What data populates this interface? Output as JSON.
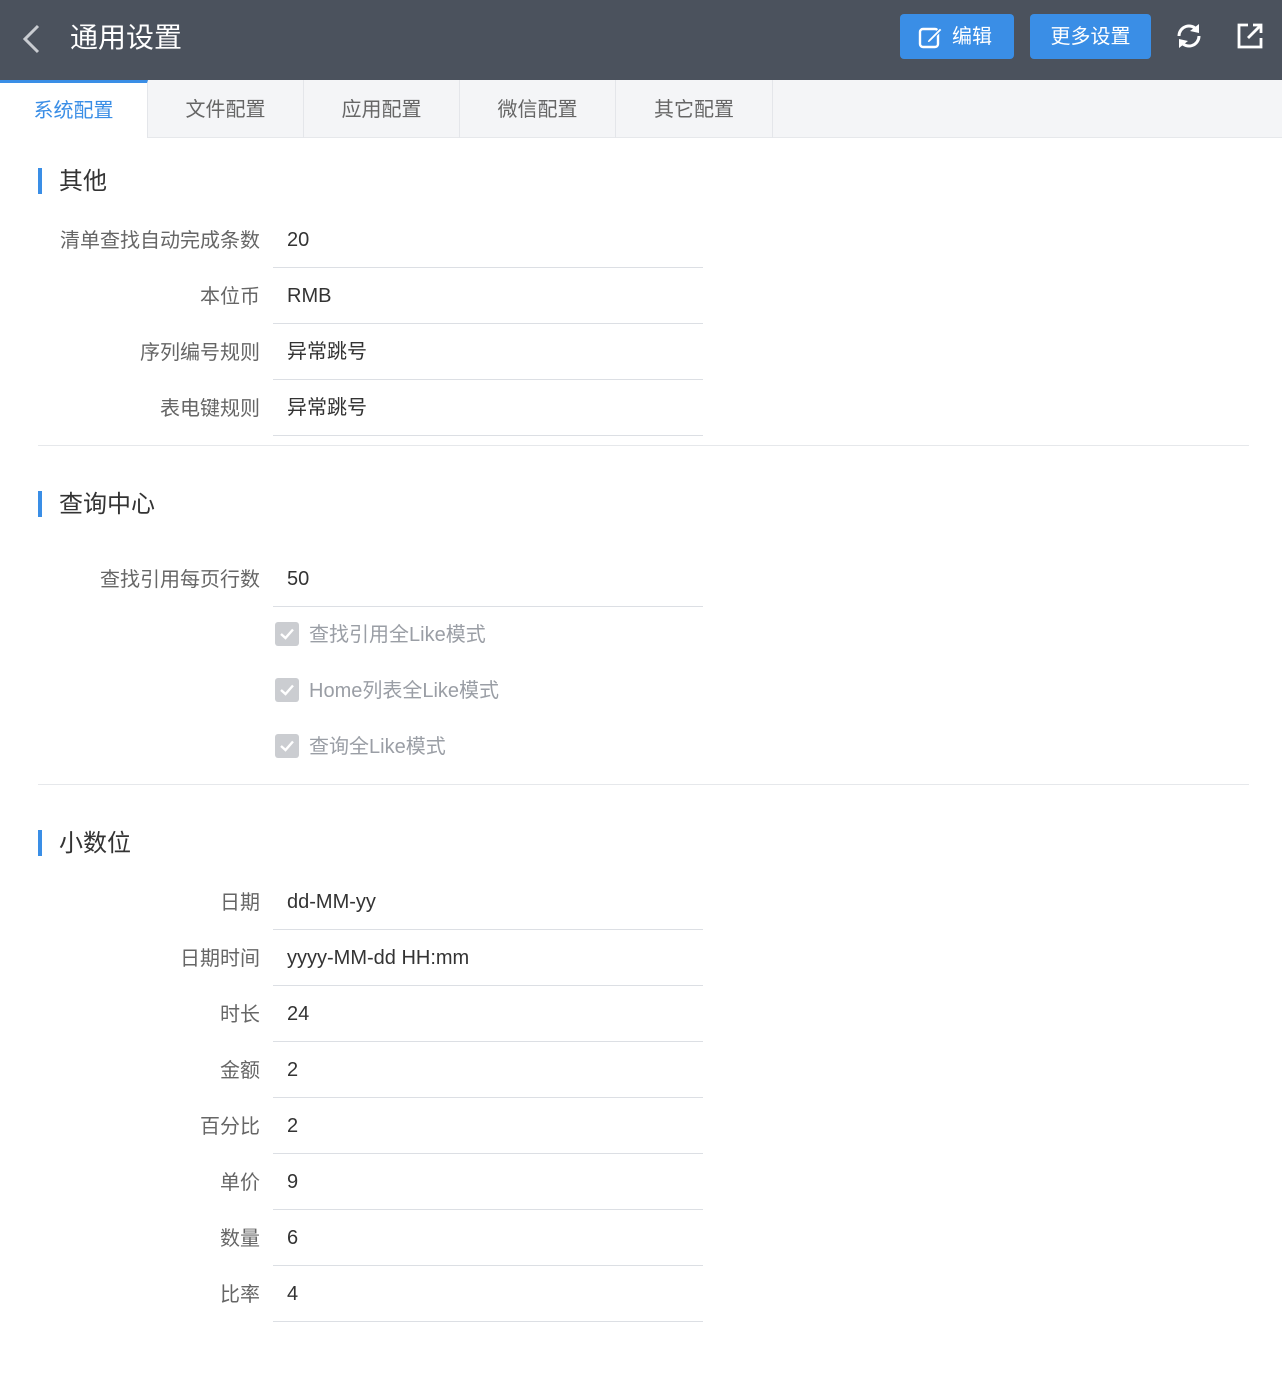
{
  "header": {
    "title": "通用设置",
    "edit_label": "编辑",
    "more_label": "更多设置",
    "icons": [
      "chevron-left-icon",
      "edit-icon",
      "refresh-icon",
      "export-icon"
    ]
  },
  "tabs": [
    {
      "label": "系统配置",
      "active": true
    },
    {
      "label": "文件配置",
      "active": false
    },
    {
      "label": "应用配置",
      "active": false
    },
    {
      "label": "微信配置",
      "active": false
    },
    {
      "label": "其它配置",
      "active": false
    }
  ],
  "sections": {
    "other": {
      "title": "其他",
      "fields": [
        {
          "label": "清单查找自动完成条数",
          "value": "20"
        },
        {
          "label": "本位币",
          "value": "RMB"
        },
        {
          "label": "序列编号规则",
          "value": "异常跳号"
        },
        {
          "label": "表电键规则",
          "value": "异常跳号"
        }
      ]
    },
    "query": {
      "title": "查询中心",
      "fields": [
        {
          "label": "查找引用每页行数",
          "value": "50"
        }
      ],
      "checkboxes": [
        {
          "label": "查找引用全Like模式",
          "checked": true
        },
        {
          "label": "Home列表全Like模式",
          "checked": true
        },
        {
          "label": "查询全Like模式",
          "checked": true
        }
      ]
    },
    "decimal": {
      "title": "小数位",
      "fields": [
        {
          "label": "日期",
          "value": "dd-MM-yy"
        },
        {
          "label": "日期时间",
          "value": "yyyy-MM-dd HH:mm"
        },
        {
          "label": "时长",
          "value": "24"
        },
        {
          "label": "金额",
          "value": "2"
        },
        {
          "label": "百分比",
          "value": "2"
        },
        {
          "label": "单价",
          "value": "9"
        },
        {
          "label": "数量",
          "value": "6"
        },
        {
          "label": "比率",
          "value": "4"
        }
      ]
    }
  },
  "colors": {
    "header_bg": "#4b525d",
    "accent": "#3a8ee6",
    "tab_bar_bg": "#f4f5f7",
    "checkbox_disabled": "#cbcdd1"
  }
}
